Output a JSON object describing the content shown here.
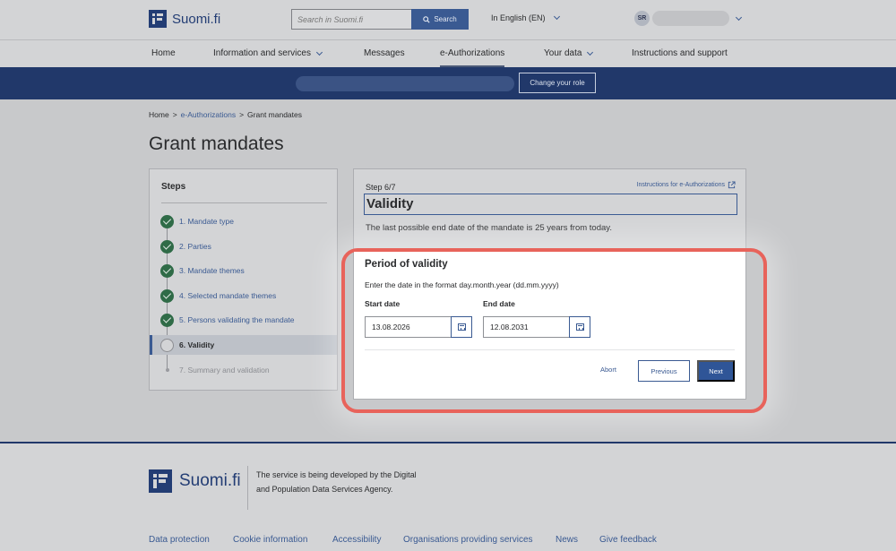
{
  "header": {
    "logo_text": "Suomi.fi",
    "search_placeholder": "Search in Suomi.fi",
    "search_button": "Search",
    "language": "In English (EN)",
    "user_initials": "SR"
  },
  "nav": {
    "items": [
      "Home",
      "Information and services",
      "Messages",
      "e-Authorizations",
      "Your data",
      "Instructions and support"
    ]
  },
  "rolebar": {
    "button": "Change your role"
  },
  "breadcrumb": {
    "home": "Home",
    "sep": ">",
    "section": "e-Authorizations",
    "current": "Grant mandates"
  },
  "page_title": "Grant mandates",
  "steps": {
    "title": "Steps",
    "items": [
      "1. Mandate type",
      "2. Parties",
      "3. Mandate themes",
      "4. Selected mandate themes",
      "5. Persons validating the mandate",
      "6. Validity",
      "7. Summary and validation"
    ]
  },
  "main": {
    "step_label": "Step 6/7",
    "instructions_link": "Instructions for e-Authorizations",
    "heading": "Validity",
    "description": "The last possible end date of the mandate is 25 years from today."
  },
  "period": {
    "title": "Period of validity",
    "hint": "Enter the date in the format day.month.year (dd.mm.yyyy)",
    "start_label": "Start date",
    "start_value": "13.08.2026",
    "end_label": "End date",
    "end_value": "12.08.2031"
  },
  "actions": {
    "abort": "Abort",
    "previous": "Previous",
    "next": "Next"
  },
  "footer": {
    "logo_text": "Suomi.fi",
    "description": "The service is being developed by the Digital and Population Data Services Agency.",
    "links": [
      "Data protection",
      "Cookie information",
      "Accessibility",
      "Organisations providing services",
      "News",
      "Give feedback"
    ]
  },
  "colors": {
    "brand": "#21386a",
    "accent": "#2f5597",
    "done": "#2f6b47",
    "highlight": "#e8635b"
  }
}
